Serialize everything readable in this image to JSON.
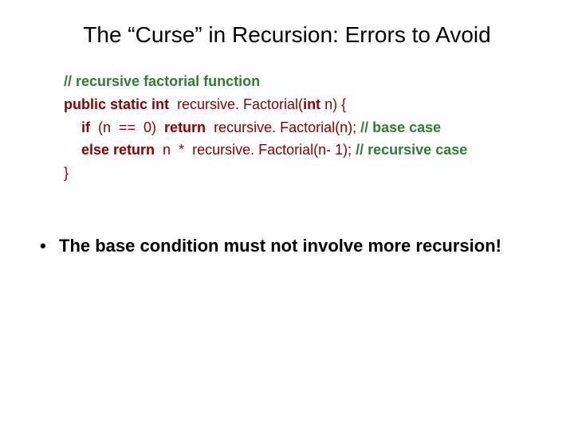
{
  "title": "The “Curse” in Recursion: Errors to Avoid",
  "code": {
    "l1_comment": "// recursive factorial function",
    "l2_kw": "public static int",
    "l2_rest": "  recursive. Factorial(",
    "l2_kw2": "int",
    "l2_rest2": " n) {",
    "l3_kw": "if",
    "l3_mid": "  (n  ==  0)  ",
    "l3_kw2": "return",
    "l3_rest": "  recursive. Factorial(n); ",
    "l3_comment": "// base case",
    "l4_kw": "else return",
    "l4_rest": "  n  *  recursive. Factorial(n- 1); ",
    "l4_comment": "// recursive case",
    "l5": "}"
  },
  "bullet": "The base condition must not involve more recursion!"
}
